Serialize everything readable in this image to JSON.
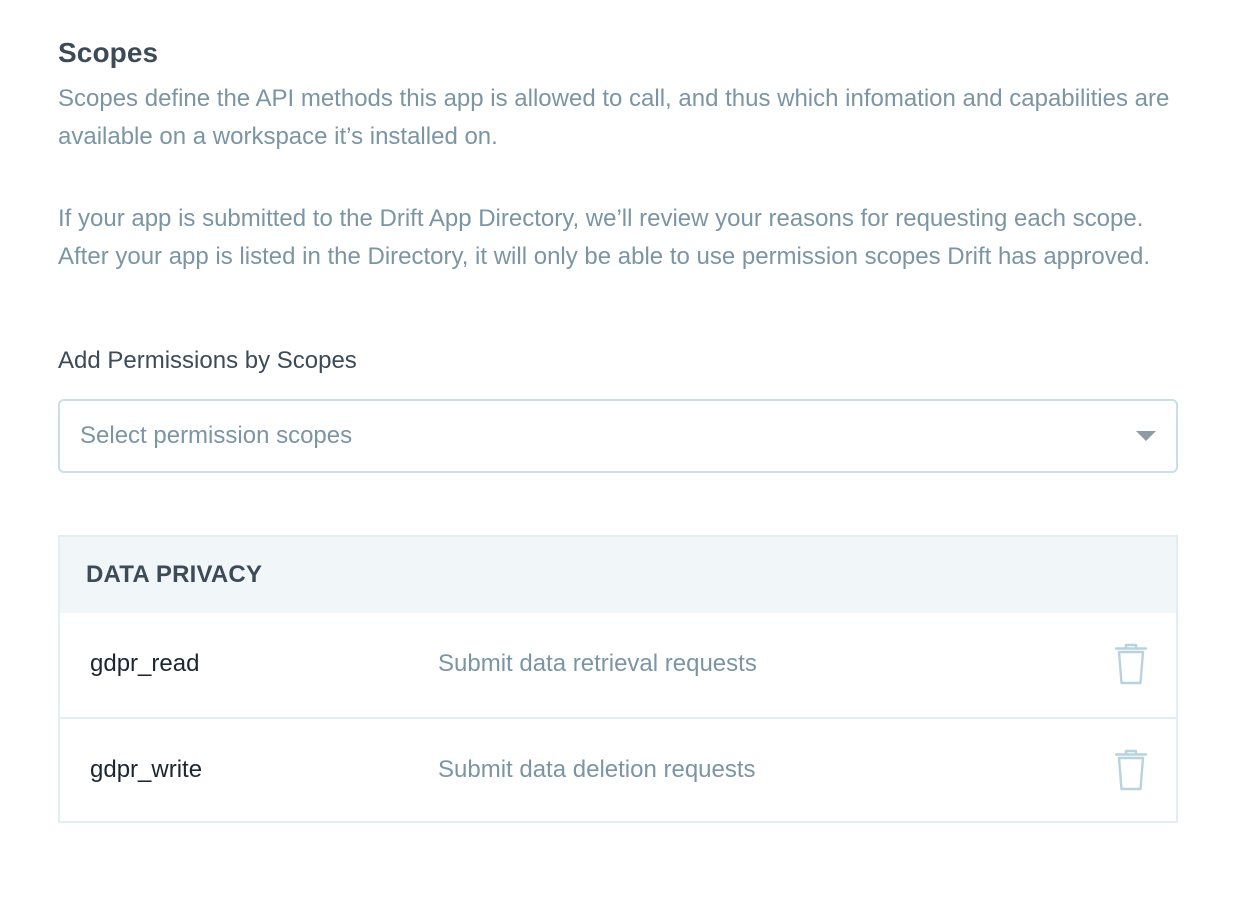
{
  "section": {
    "title": "Scopes",
    "description_1": "Scopes define the API methods this app is allowed to call, and thus which infomation and capabilities are available on a workspace it’s installed on.",
    "description_2": "If your app is submitted to the Drift App Directory, we’ll review your reasons for requesting each scope. After your app is listed in the Directory, it will only be able to use permission scopes Drift has approved."
  },
  "permissions": {
    "label": "Add Permissions by Scopes",
    "select_placeholder": "Select permission scopes",
    "dropdown_icon": "chevron-down-icon"
  },
  "scope_groups": [
    {
      "name": "DATA PRIVACY",
      "scopes": [
        {
          "name": "gdpr_read",
          "description": "Submit data retrieval requests",
          "action_icon": "trash-icon"
        },
        {
          "name": "gdpr_write",
          "description": "Submit data deletion requests",
          "action_icon": "trash-icon"
        }
      ]
    }
  ],
  "colors": {
    "heading": "#3d4b58",
    "muted_text": "#7b95a5",
    "border": "#c8dfe7",
    "table_border": "#e3eef3",
    "group_header_bg": "#f1f6f8",
    "icon": "#b8d3dd"
  }
}
